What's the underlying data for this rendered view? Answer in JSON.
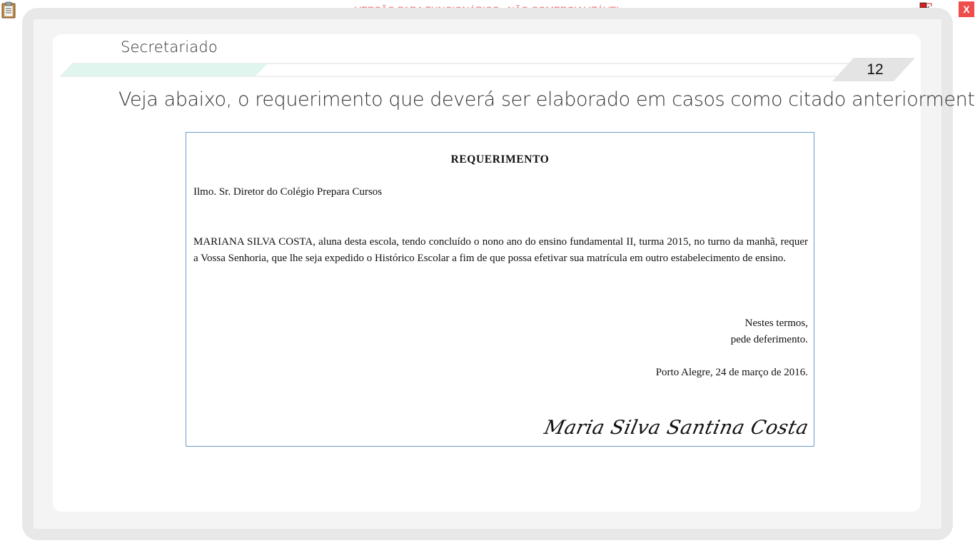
{
  "window": {
    "banner": "VERSÃO PARA FUNCIONÁRIOS - NÃO COMERCIALIZÁVEL",
    "close_label": "X",
    "icons": [
      "clipboard-icon",
      "network-icon"
    ]
  },
  "header": {
    "section_title": "Secretariado",
    "page_number": "12",
    "progress_fraction": 0.25
  },
  "main": {
    "intro": "Veja abaixo, o requerimento que deverá ser elaborado em casos como citado anteriormente."
  },
  "document": {
    "title": "REQUERIMENTO",
    "addressee": "Ilmo. Sr. Diretor do Colégio Prepara Cursos",
    "body": "MARIANA SILVA COSTA, aluna desta escola, tendo concluído o nono ano do ensino fundamental II, turma 2015, no turno da manhã, requer a Vossa Senhoria, que lhe seja expedido o Histórico Escolar a fim de que possa efetivar sua matrícula em outro estabelecimento de ensino.",
    "closing_line_1": "Nestes termos,",
    "closing_line_2": "pede deferimento.",
    "date": "Porto Alegre, 24 de março de 2016.",
    "signature": "Maria Silva Santina Costa"
  },
  "colors": {
    "banner_text": "#ee6b6b",
    "close_button": "#ef4c4c",
    "progress_fill": "#dff5ee",
    "document_border": "#6b9cc8"
  }
}
